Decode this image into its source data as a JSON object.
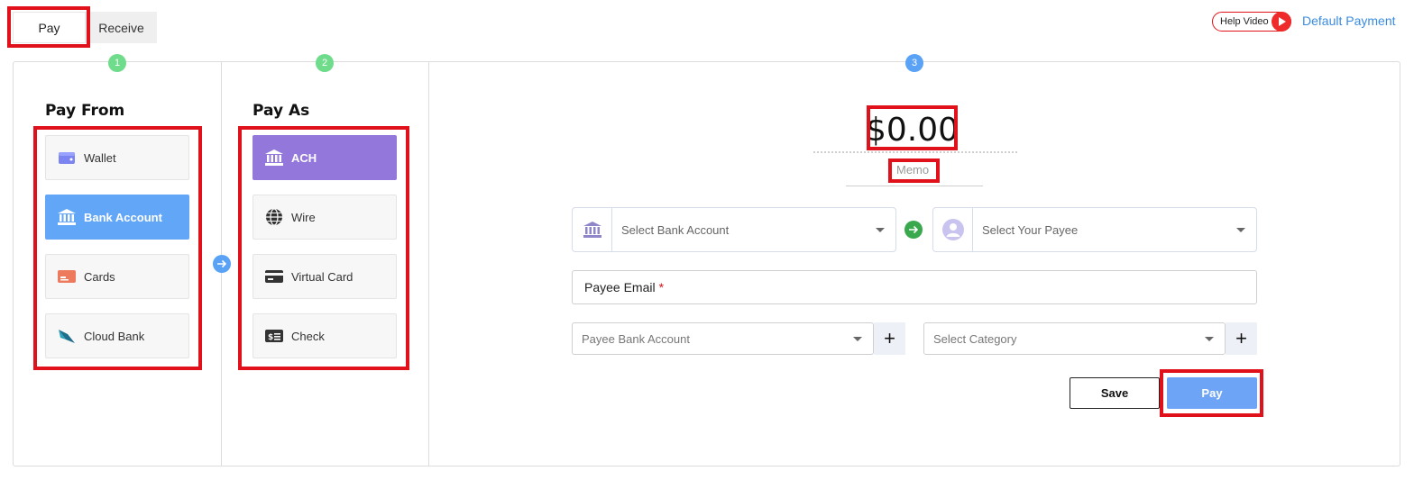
{
  "tabs": [
    {
      "label": "Pay",
      "active": true
    },
    {
      "label": "Receive",
      "active": false
    }
  ],
  "header": {
    "help_video": "Help Video",
    "default_payment": "Default Payment"
  },
  "steps": [
    "1",
    "2",
    "3"
  ],
  "pay_from": {
    "title": "Pay From",
    "options": [
      {
        "label": "Wallet",
        "icon": "wallet-icon",
        "selected": false
      },
      {
        "label": "Bank Account",
        "icon": "bank-icon",
        "selected": true
      },
      {
        "label": "Cards",
        "icon": "card-icon",
        "selected": false
      },
      {
        "label": "Cloud Bank",
        "icon": "cloud-bank-icon",
        "selected": false
      }
    ]
  },
  "pay_as": {
    "title": "Pay As",
    "options": [
      {
        "label": "ACH",
        "icon": "bank-icon",
        "selected": true
      },
      {
        "label": "Wire",
        "icon": "globe-icon",
        "selected": false
      },
      {
        "label": "Virtual Card",
        "icon": "virtual-card-icon",
        "selected": false
      },
      {
        "label": "Check",
        "icon": "check-icon",
        "selected": false
      }
    ]
  },
  "payment": {
    "amount": "$0.00",
    "memo_placeholder": "Memo",
    "bank_account_placeholder": "Select Bank Account",
    "payee_placeholder": "Select Your Payee",
    "payee_email_label": "Payee Email",
    "required_mark": "*",
    "payee_bank_account_placeholder": "Payee Bank Account",
    "category_placeholder": "Select Category",
    "plus": "+",
    "save_label": "Save",
    "pay_label": "Pay"
  },
  "colors": {
    "highlight": "#e0111b",
    "selected_blue": "#62a6f8",
    "selected_purple": "#9477db",
    "pay_button": "#6ea4f6",
    "step1": "#6fdc8c",
    "step2": "#6fdc8c",
    "step3": "#5aa2f5"
  }
}
